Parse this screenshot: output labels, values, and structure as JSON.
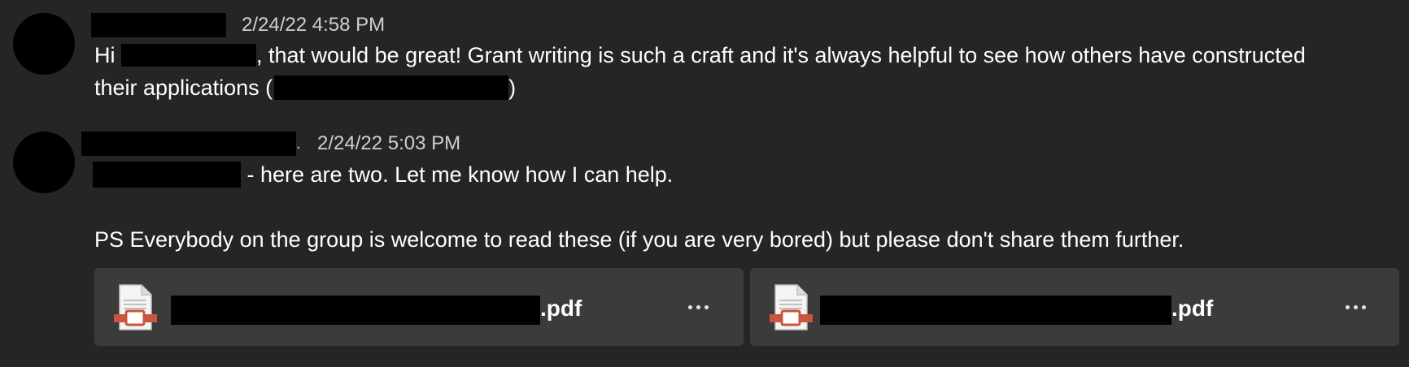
{
  "messages": [
    {
      "timestamp": "2/24/22 4:58 PM",
      "body": {
        "line1_prefix": "Hi ",
        "line1_suffix": ", that would be great! Grant writing is such a craft and it's always helpful to see how others have constructed",
        "line2_prefix": "their applications (",
        "line2_suffix": ")"
      }
    },
    {
      "timestamp": "2/24/22 5:03 PM",
      "sender_suffix": ".",
      "body": {
        "line1_suffix": " - here are two. Let me know how I can help.",
        "line2": "PS Everybody on the group is welcome to read these (if you are very bored) but please don't share them further."
      },
      "attachments": [
        {
          "extension": ".pdf",
          "icon": "pdf-file-icon",
          "more_icon": "more-options-icon"
        },
        {
          "extension": ".pdf",
          "icon": "pdf-file-icon",
          "more_icon": "more-options-icon"
        }
      ]
    }
  ],
  "colors": {
    "background": "#252525",
    "card": "#3b3b3b",
    "text": "#ffffff",
    "timestamp": "#cfcfcf",
    "redaction": "#000000",
    "pdf_accent": "#c8553d"
  }
}
